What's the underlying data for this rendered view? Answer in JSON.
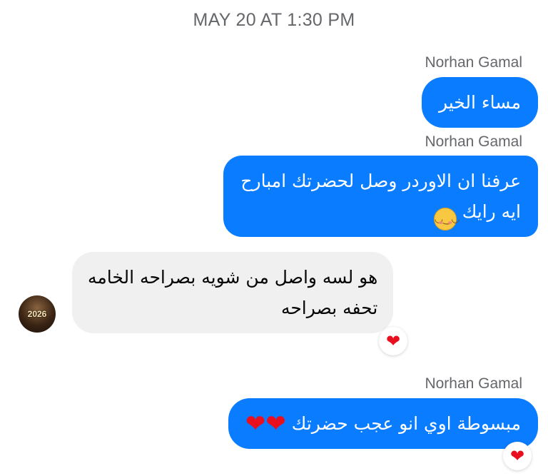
{
  "timestamp": "MAY 20 AT 1:30 PM",
  "messages": [
    {
      "sender": "Norhan Gamal",
      "direction": "outgoing",
      "lines": [
        "مساء الخير"
      ]
    },
    {
      "sender": "Norhan Gamal",
      "direction": "outgoing",
      "lines": [
        "عرفنا ان الاوردر وصل لحضرتك امبارح",
        "ايه رايك"
      ],
      "emoji": "smiling-face"
    },
    {
      "sender": "",
      "direction": "incoming",
      "lines": [
        "هو لسه واصل من شويه بصراحه الخامه",
        "تحفه بصراحه"
      ],
      "reaction": "❤"
    },
    {
      "sender": "Norhan Gamal",
      "direction": "outgoing",
      "lines": [
        "مبسوطة اوي انو عجب حضرتك"
      ],
      "emoji_text": "❤❤",
      "reaction": "❤"
    }
  ],
  "avatar": {
    "label": "2026"
  },
  "colors": {
    "outgoing_bubble": "#0a7cff",
    "incoming_bubble": "#f0f0f0",
    "meta_text": "#65676b",
    "heart": "#e8101f"
  }
}
